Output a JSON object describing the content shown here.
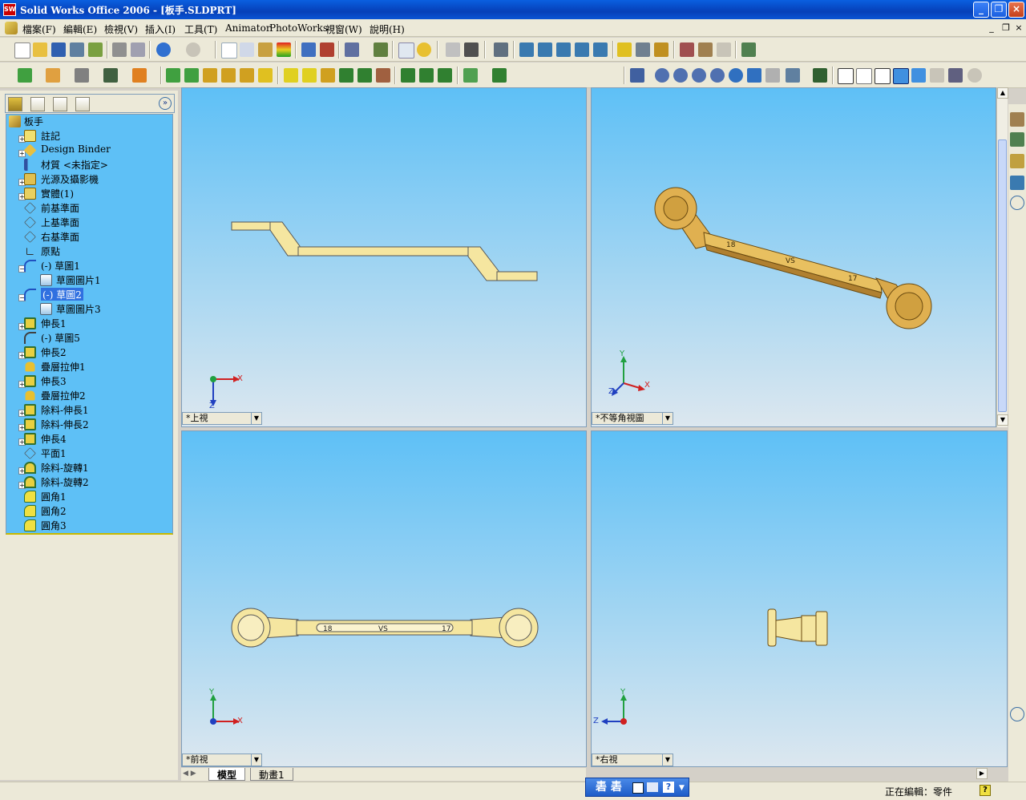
{
  "window": {
    "app_icon_text": "SW",
    "title": "Solid Works Office 2006 - [板手.SLDPRT]"
  },
  "menu": {
    "items": [
      "檔案(F)",
      "編輯(E)",
      "檢視(V)",
      "插入(I)",
      "工具(T)",
      "Animator",
      "PhotoWorks",
      "視窗(W)",
      "說明(H)"
    ]
  },
  "feature_tree": {
    "root": "板手",
    "items": [
      "註記",
      "Design Binder",
      "材質 <未指定>",
      "光源及攝影機",
      "實體(1)",
      "前基準面",
      "上基準面",
      "右基準面",
      "原點",
      "(-) 草圖1",
      "草圖圖片1",
      "(-) 草圖2",
      "草圖圖片3",
      "伸長1",
      "(-) 草圖5",
      "伸長2",
      "疊層拉伸1",
      "伸長3",
      "疊層拉伸2",
      "除料-伸長1",
      "除料-伸長2",
      "伸長4",
      "平面1",
      "除料-旋轉1",
      "除料-旋轉2",
      "圓角1",
      "圓角2",
      "圓角3"
    ]
  },
  "viewports": {
    "top": {
      "label": "*上視",
      "axes": [
        "X",
        "Z"
      ]
    },
    "iso": {
      "label": "*不等角視圖",
      "axes": [
        "Y",
        "X",
        "Z"
      ]
    },
    "front": {
      "label": "*前視",
      "axes": [
        "Y",
        "X"
      ]
    },
    "right": {
      "label": "*右視",
      "axes": [
        "Y",
        "Z"
      ]
    }
  },
  "wrench": {
    "left_size": "18",
    "middle_text": "VS",
    "right_size": "17"
  },
  "tabs": {
    "model": "模型",
    "animation": "動畫1"
  },
  "status": {
    "editing": "正在編輯：零件",
    "help_icon_text": "?"
  },
  "ime": {
    "text": "砉 砉"
  },
  "icons": {
    "close": "×",
    "restore": "❐",
    "minimize": "_",
    "expand_panel": "»",
    "dropdown": "▼",
    "tree_expand": "+",
    "tree_collapse": "−"
  },
  "colors": {
    "viewport_top": "#5ec0f6",
    "viewport_bottom": "#dce7ef",
    "wrench_fill": "#f5e6a0",
    "wrench_iso": "#d9a84a",
    "titlebar": "#0a54d4"
  }
}
